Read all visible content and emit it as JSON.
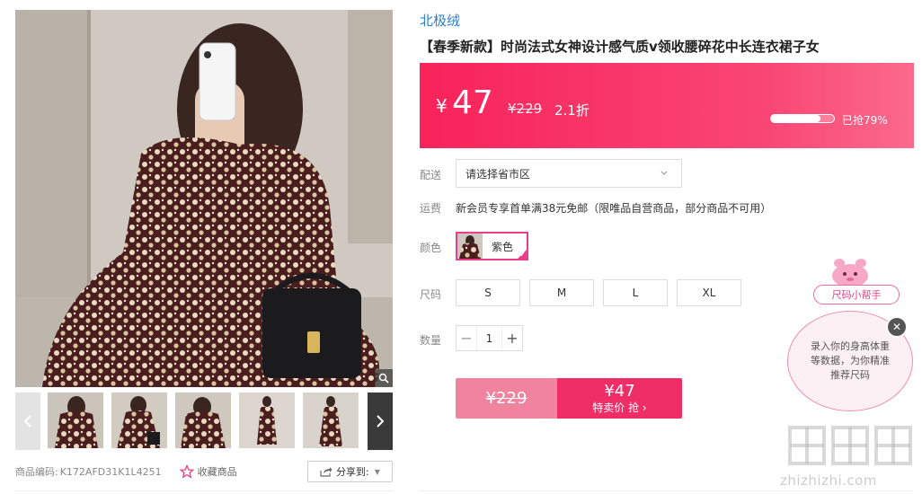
{
  "gallery": {
    "zoom_icon": "magnifier-icon",
    "prev_icon": "chevron-left-icon",
    "next_icon": "chevron-right-icon",
    "thumb_count": 5
  },
  "meta": {
    "sku_label": "商品编码:",
    "sku_value": "K172AFD31K1L4251",
    "favorite_label": "收藏商品",
    "share_label": "分享到:"
  },
  "product": {
    "brand": "北极绒",
    "title": "【春季新款】时尚法式女神设计感气质v领收腰碎花中长连衣裙子女"
  },
  "price": {
    "currency": "¥",
    "current": "47",
    "original": "¥229",
    "discount": "2.1折",
    "sold_text": "已抢79%",
    "sold_fraction": 0.79,
    "accent": "#f8235a"
  },
  "delivery": {
    "label": "配送",
    "placeholder": "请选择省市区"
  },
  "shipping": {
    "label": "运费",
    "text": "新会员专享首单满38元免邮（限唯品自营商品，部分商品不可用）"
  },
  "color": {
    "label": "颜色",
    "selected": "紫色",
    "selected_color": "#e83e8c"
  },
  "size": {
    "label": "尺码",
    "options": [
      "S",
      "M",
      "L",
      "XL"
    ]
  },
  "quantity": {
    "label": "数量",
    "minus": "−",
    "value": "1",
    "plus": "+"
  },
  "buy": {
    "original": "¥229",
    "special_price": "¥47",
    "special_label": "特卖价 抢 ›"
  },
  "helper": {
    "tag": "尺码小帮手",
    "bubble": "录入你的身高体重等数据，为你精准推荐尺码",
    "close": "✕"
  },
  "watermark": {
    "text": "zhizhizhi.com"
  }
}
